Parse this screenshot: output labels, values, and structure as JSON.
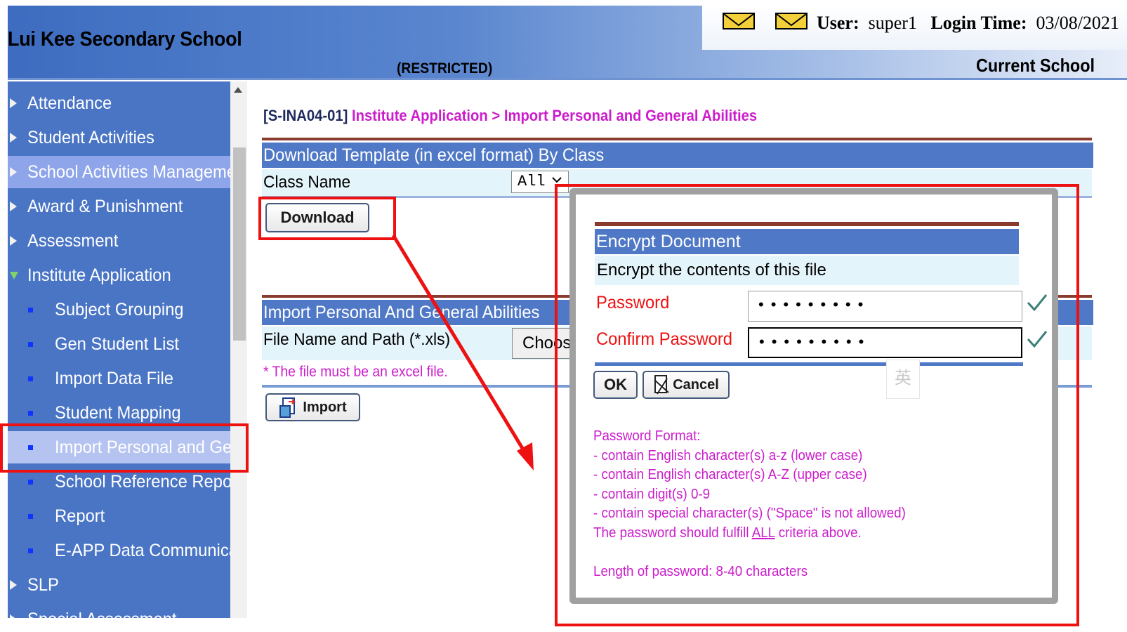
{
  "header": {
    "school_name": "Lui Kee Secondary School",
    "restricted": "(RESTRICTED)",
    "user_label": "User:",
    "user_value": "super1",
    "login_label": "Login Time:",
    "login_value": "03/08/2021",
    "current_school": "Current School",
    "mail_icon": "envelope-icon"
  },
  "sidebar": {
    "items": [
      {
        "label": "Attendance"
      },
      {
        "label": "Student Activities"
      },
      {
        "label": "School Activities Management"
      },
      {
        "label": "Award & Punishment"
      },
      {
        "label": "Assessment"
      },
      {
        "label": "Institute Application"
      },
      {
        "label": "Subject Grouping"
      },
      {
        "label": "Gen Student List"
      },
      {
        "label": "Import Data File"
      },
      {
        "label": "Student Mapping"
      },
      {
        "label": "Import Personal and General Abilities"
      },
      {
        "label": "School Reference Report"
      },
      {
        "label": "Report"
      },
      {
        "label": "E-APP Data Communication"
      },
      {
        "label": "SLP"
      },
      {
        "label": "Special Assessment"
      }
    ]
  },
  "breadcrumb": {
    "code": "[S-INA04-01]",
    "path": "Institute Application > Import Personal and General Abilities"
  },
  "download_section": {
    "title": "Download Template (in excel format) By Class",
    "class_label": "Class Name",
    "class_value": "All",
    "download_button": "Download"
  },
  "import_section": {
    "title": "Import Personal And General Abilities",
    "file_label": "File Name and Path (*.xls)",
    "choose_button": "Choose File",
    "note": "* The file must be an excel file.",
    "import_button": "Import"
  },
  "dialog": {
    "title": "Encrypt Document",
    "subtitle": "Encrypt the contents of this file",
    "password_label": "Password",
    "password_value": "•••••••••",
    "confirm_label": "Confirm Password",
    "confirm_value": "•••••••••",
    "ok_button": "OK",
    "cancel_button": "Cancel",
    "ime_indicator": "英",
    "format_title": "Password Format:",
    "format_rules": [
      "- contain English character(s) a-z (lower case)",
      "- contain English character(s) A-Z (upper case)",
      "- contain digit(s) 0-9",
      "- contain special character(s) (\"Space\" is not allowed)"
    ],
    "fulfill_pre": "The password should fulfill ",
    "fulfill_all": "ALL",
    "fulfill_post": " criteria above.",
    "length_note": "Length of password: 8-40 characters"
  },
  "colors": {
    "sidebar_bg": "#4a75c5",
    "section_bar": "#4f78c6",
    "accent_magenta": "#cc1dcc",
    "annotation_red": "#ee1111"
  }
}
